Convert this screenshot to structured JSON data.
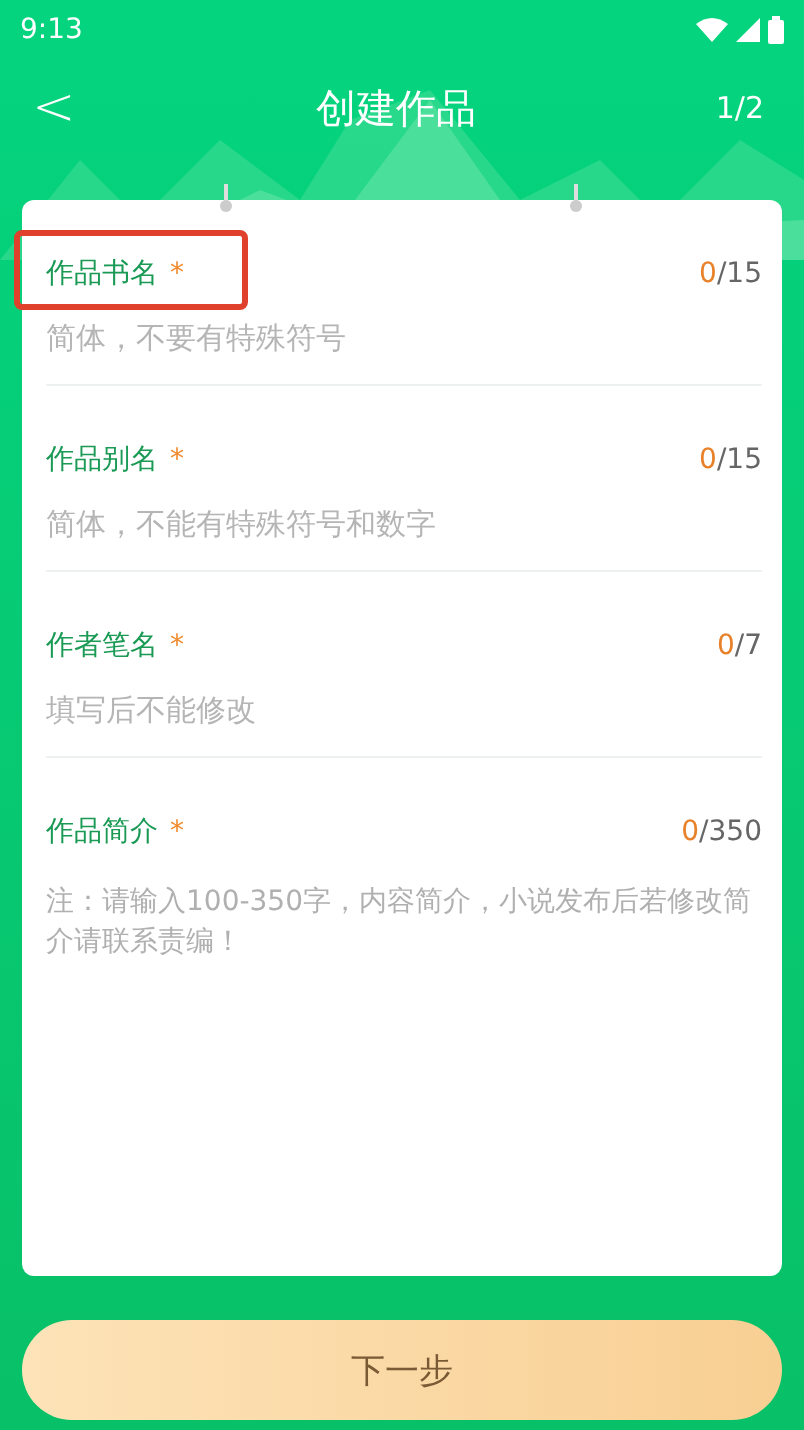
{
  "status_bar": {
    "time": "9:13"
  },
  "header": {
    "back": "<",
    "title": "创建作品",
    "step": "1/2"
  },
  "fields": [
    {
      "label": "作品书名",
      "required": "*",
      "highlighted": true,
      "count": "0",
      "max": "/15",
      "placeholder": "简体，不要有特殊符号",
      "kind": "line"
    },
    {
      "label": "作品别名",
      "required": "*",
      "highlighted": false,
      "count": "0",
      "max": "/15",
      "placeholder": "简体，不能有特殊符号和数字",
      "kind": "line"
    },
    {
      "label": "作者笔名",
      "required": "*",
      "highlighted": false,
      "count": "0",
      "max": "/7",
      "placeholder": "填写后不能修改",
      "kind": "line"
    },
    {
      "label": "作品简介",
      "required": "*",
      "highlighted": false,
      "count": "0",
      "max": "/350",
      "placeholder": "注：请输入100-350字，内容简介，小说发布后若修改简介请联系责编！",
      "kind": "area"
    }
  ],
  "next_button": "下一步"
}
